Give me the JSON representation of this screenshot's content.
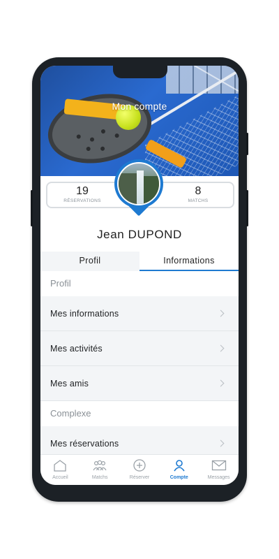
{
  "header": {
    "title": "Mon compte"
  },
  "stats": {
    "reservations": {
      "value": "19",
      "label": "RÉSERVATIONS"
    },
    "matchs": {
      "value": "8",
      "label": "MATCHS"
    }
  },
  "user": {
    "name": "Jean DUPOND"
  },
  "tabs": [
    {
      "label": "Profil",
      "active": false
    },
    {
      "label": "Informations",
      "active": true
    }
  ],
  "sections": {
    "profil": {
      "title": "Profil",
      "items": [
        {
          "label": "Mes informations"
        },
        {
          "label": "Mes activités"
        },
        {
          "label": "Mes amis"
        }
      ]
    },
    "complexe": {
      "title": "Complexe",
      "items": [
        {
          "label": "Mes réservations"
        }
      ]
    }
  },
  "bottom_nav": [
    {
      "label": "Accueil",
      "icon": "home-icon",
      "active": false
    },
    {
      "label": "Matchs",
      "icon": "group-icon",
      "active": false
    },
    {
      "label": "Réserver",
      "icon": "plus-circle-icon",
      "active": false
    },
    {
      "label": "Compte",
      "icon": "user-icon",
      "active": true
    },
    {
      "label": "Messages",
      "icon": "mail-icon",
      "active": false
    }
  ],
  "colors": {
    "accent": "#1e7ad1",
    "phone_frame": "#1c2126",
    "list_bg": "#f3f5f7"
  }
}
